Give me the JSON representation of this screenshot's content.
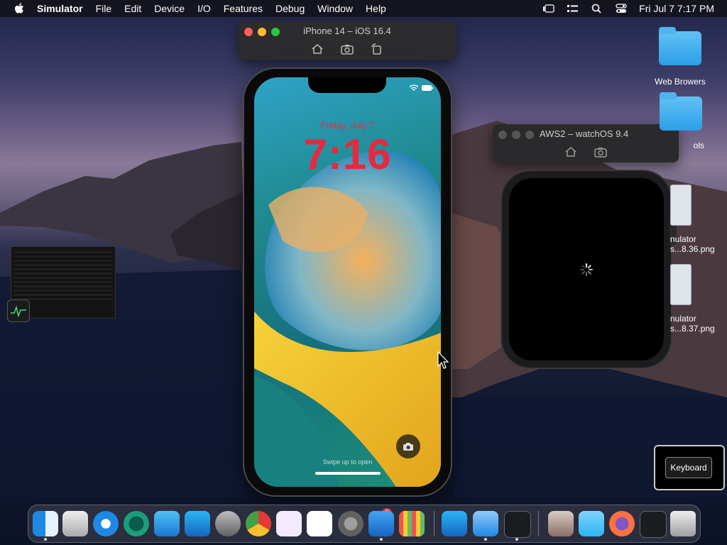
{
  "menubar": {
    "app_name": "Simulator",
    "items": [
      "File",
      "Edit",
      "Device",
      "I/O",
      "Features",
      "Debug",
      "Window",
      "Help"
    ],
    "datetime": "Fri Jul 7  7:17 PM"
  },
  "iphone_window": {
    "title": "iPhone 14 – iOS 16.4",
    "lock_date": "Friday, July 7",
    "lock_time": "7:16",
    "swipe_hint": "Swipe up to open"
  },
  "watch_window": {
    "title": "AWS2 – watchOS 9.4"
  },
  "desktop": {
    "items": [
      {
        "label": "Web Browers"
      },
      {
        "label": "ols"
      },
      {
        "label": "nulator\ns...8.36.png"
      },
      {
        "label": "nulator\ns...8.37.png"
      }
    ]
  },
  "keyboard_popup": {
    "button_label": "Keyboard"
  },
  "dock": {
    "apps": [
      "finder-icon",
      "script-editor-icon",
      "safari-icon",
      "time-machine-icon",
      "transporter-icon",
      "app-store-icon",
      "automator-icon",
      "chrome-icon",
      "visual-studio-icon",
      "vscode-icon",
      "system-settings-icon",
      "xcode-simulator-icon",
      "launchpad-icon",
      "app-store-icon-2",
      "xcode-icon",
      "activity-monitor-icon",
      "archive-utility-icon",
      "downloads-folder-icon",
      "firefox-icon",
      "activity-monitor-icon-2",
      "trash-icon"
    ],
    "badge_count": "2"
  },
  "colors": {
    "lock_time": "#e8283d",
    "menu_bg": "#14141c",
    "traffic_red": "#fe5f57",
    "traffic_yellow": "#febc2e",
    "traffic_green": "#28c840"
  }
}
